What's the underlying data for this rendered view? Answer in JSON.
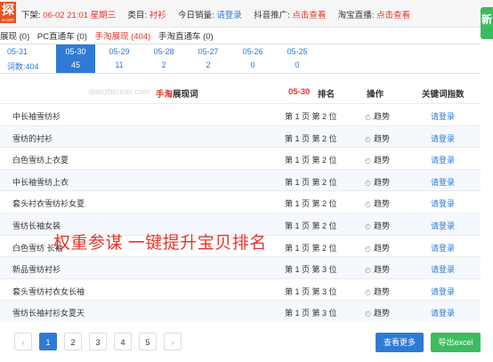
{
  "topbar": {
    "logo_char": "探",
    "logo_sub": "e.com",
    "listing_label": "下架:",
    "listing_time": "06-02 21:01 星期三",
    "category_label": "类目:",
    "category_value": "衬衫",
    "sales_label": "今日销量:",
    "sales_value": "请登录",
    "douyin_label": "抖音推广:",
    "douyin_value": "点击查看",
    "taobao_label": "淘宝直播:",
    "taobao_value": "点击查看",
    "new_button": "新"
  },
  "subtabs": [
    {
      "label": "展现 (0)",
      "active": false
    },
    {
      "label": "PC直通车 (0)",
      "active": false
    },
    {
      "label": "手淘展现 (404)",
      "active": true
    },
    {
      "label": "手淘直通车 (0)",
      "active": false
    }
  ],
  "dates": [
    {
      "date": "05-31",
      "count": "词数:404",
      "selected": false
    },
    {
      "date": "05-30",
      "count": "45",
      "selected": true
    },
    {
      "date": "05-29",
      "count": "11",
      "selected": false
    },
    {
      "date": "05-28",
      "count": "2",
      "selected": false
    },
    {
      "date": "05-27",
      "count": "2",
      "selected": false
    },
    {
      "date": "05-26",
      "count": "0",
      "selected": false
    },
    {
      "date": "05-25",
      "count": "0",
      "selected": false
    }
  ],
  "table": {
    "watermark": "dianzhentan.com",
    "keyword_header_red": "手淘",
    "keyword_header": "展现词",
    "date_header": "05-30",
    "rank_header": "排名",
    "op_header": "操作",
    "index_header": "关键词指数",
    "rows": [
      {
        "keyword": "中长袖雪纺衫",
        "rank": "第 1 页 第 2 位",
        "op": "趋势",
        "index": "请登录"
      },
      {
        "keyword": "雪纺的衬衫",
        "rank": "第 1 页 第 2 位",
        "op": "趋势",
        "index": "请登录"
      },
      {
        "keyword": "白色雪纺上衣夏",
        "rank": "第 1 页 第 2 位",
        "op": "趋势",
        "index": "请登录"
      },
      {
        "keyword": "中长袖雪纺上衣",
        "rank": "第 1 页 第 2 位",
        "op": "趋势",
        "index": "请登录"
      },
      {
        "keyword": "套头衬衣雪纺衫女夏",
        "rank": "第 1 页 第 2 位",
        "op": "趋势",
        "index": "请登录"
      },
      {
        "keyword": "雪纺长袖女装",
        "rank": "第 1 页 第 2 位",
        "op": "趋势",
        "index": "请登录"
      },
      {
        "keyword": "白色雪纺 长袖",
        "rank": "第 1 页 第 2 位",
        "op": "趋势",
        "index": "请登录"
      },
      {
        "keyword": "新品雪纺衬衫",
        "rank": "第 1 页 第 3 位",
        "op": "趋势",
        "index": "请登录"
      },
      {
        "keyword": "套头雪纺衬衣女长袖",
        "rank": "第 1 页 第 3 位",
        "op": "趋势",
        "index": "请登录"
      },
      {
        "keyword": "雪纺长袖衬衫女夏天",
        "rank": "第 1 页 第 3 位",
        "op": "趋势",
        "index": "请登录"
      }
    ]
  },
  "overlay_text": "权重参谋   一键提升宝贝排名",
  "pagination": {
    "prev": "‹",
    "next": "›",
    "pages": [
      "1",
      "2",
      "3",
      "4",
      "5"
    ],
    "current": "1"
  },
  "buttons": {
    "more": "查看更多",
    "export": "导出excel"
  },
  "colors": {
    "accent_blue": "#2e7bd6",
    "accent_red": "#e5352b",
    "accent_green": "#3dbb5f",
    "logo_orange": "#e8531f"
  },
  "icons": {
    "trend": "clock-circle-icon"
  }
}
